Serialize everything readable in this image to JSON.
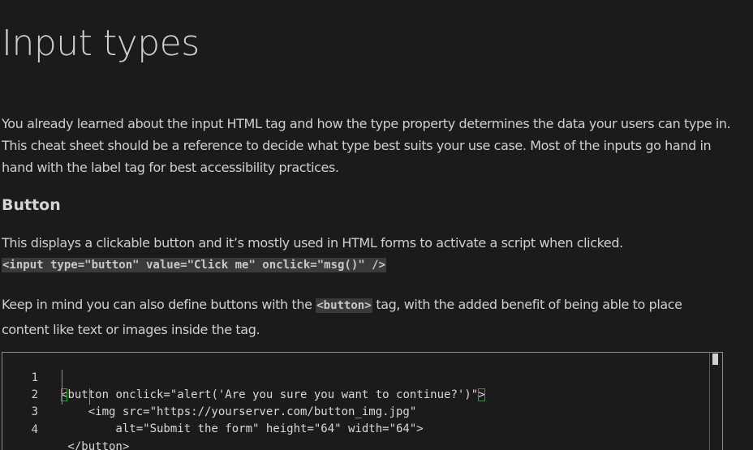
{
  "title": "Input types",
  "intro": "You already learned about the input HTML tag and how the type property determines the data your users can type in. This cheat sheet should be a reference to decide what type best suits your use case. Most of the inputs go hand in hand with the label tag for best accessibility practices.",
  "section": {
    "heading": "Button",
    "description": "This displays a clickable button and it’s mostly used in HTML forms to activate a script when clicked.",
    "example_code": "<input type=\"button\" value=\"Click me\" onclick=\"msg()\" />",
    "tip_before": "Keep in mind you can also define buttons with the ",
    "tip_code": "<button>",
    "tip_after": " tag, with the added benefit of being able to place content like text or images inside the tag."
  },
  "code_block": {
    "lines": [
      {
        "number": "1",
        "code": "button onclick=\"alert('Are you sure you want to continue?')\"",
        "open_bracket": "<",
        "close_bracket": ">"
      },
      {
        "number": "2",
        "code": "    <img src=\"https://yourserver.com/button_img.jpg\""
      },
      {
        "number": "3",
        "code": "        alt=\"Submit the form\" height=\"64\" width=\"64\">"
      },
      {
        "number": "4",
        "code": " </button>"
      }
    ]
  }
}
